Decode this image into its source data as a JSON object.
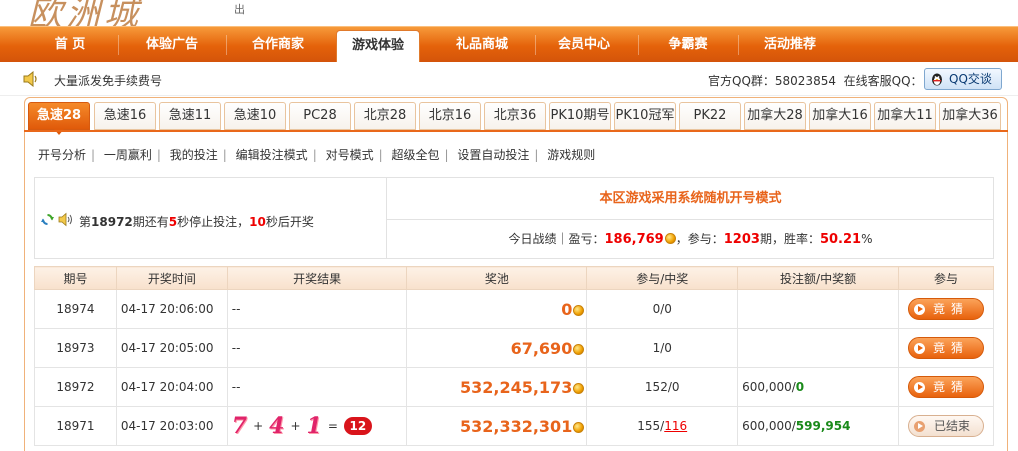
{
  "header": {
    "logo_text": "欧洲城",
    "logo_sub": "出"
  },
  "nav": {
    "items": [
      {
        "label": "首 页"
      },
      {
        "label": "体验广告"
      },
      {
        "label": "合作商家"
      },
      {
        "label": "游戏体验",
        "active": true
      },
      {
        "label": "礼品商城"
      },
      {
        "label": "会员中心"
      },
      {
        "label": "争霸赛"
      },
      {
        "label": "活动推荐"
      }
    ]
  },
  "notice": {
    "text": "大量派发免手续费号",
    "qq_group": "官方QQ群：58023854",
    "online_service": "在线客服QQ：",
    "qq_button": "QQ交谈"
  },
  "game_tabs": [
    {
      "label": "急速28",
      "active": true
    },
    {
      "label": "急速16"
    },
    {
      "label": "急速11"
    },
    {
      "label": "急速10"
    },
    {
      "label": "PC28"
    },
    {
      "label": "北京28"
    },
    {
      "label": "北京16"
    },
    {
      "label": "北京36"
    },
    {
      "label": "PK10期号"
    },
    {
      "label": "PK10冠军"
    },
    {
      "label": "PK22"
    },
    {
      "label": "加拿大28"
    },
    {
      "label": "加拿大16"
    },
    {
      "label": "加拿大11"
    },
    {
      "label": "加拿大36"
    }
  ],
  "sublinks": [
    "开号分析",
    "一周赢利",
    "我的投注",
    "编辑投注模式",
    "对号模式",
    "超级全包",
    "设置自动投注",
    "游戏规则"
  ],
  "countdown": {
    "prefix": "第",
    "issue": "18972",
    "mid1": "期还有",
    "stop_seconds": "5",
    "mid2": "秒停止投注，",
    "open_seconds": "10",
    "suffix": "秒后开奖"
  },
  "headline": "本区游戏采用系统随机开号模式",
  "stats": {
    "label_today": "今日战绩｜盈亏：",
    "profit": "186,769",
    "label_participation": "，参与：",
    "periods": "1203",
    "label_periods_unit": "期，胜率：",
    "win_rate": "50.21",
    "percent": "%"
  },
  "table": {
    "headers": [
      "期号",
      "开奖时间",
      "开奖结果",
      "奖池",
      "参与/中奖",
      "投注额/中奖额",
      "参与"
    ],
    "rows": [
      {
        "issue": "18974",
        "time": "04-17  20:06:00",
        "result": "--",
        "pool": "0",
        "participation": "0/0",
        "bet": "",
        "win": "",
        "action": "竟猜"
      },
      {
        "issue": "18973",
        "time": "04-17  20:05:00",
        "result": "--",
        "pool": "67,690",
        "participation": "1/0",
        "bet": "",
        "win": "",
        "action": "竟猜"
      },
      {
        "issue": "18972",
        "time": "04-17  20:04:00",
        "result": "--",
        "pool": "532,245,173",
        "participation": "152/0",
        "bet": "600,000/",
        "win": "0",
        "action": "竟猜"
      },
      {
        "issue": "18971",
        "time": "04-17  20:03:00",
        "result": "",
        "pool": "532,332,301",
        "participation_a": "155/",
        "participation_b": "116",
        "bet": "600,000/",
        "win": "599,954",
        "action": "已结束",
        "balls": [
          "7",
          "4",
          "1"
        ],
        "plus": "+",
        "equals": "=",
        "sum": "12"
      }
    ]
  }
}
